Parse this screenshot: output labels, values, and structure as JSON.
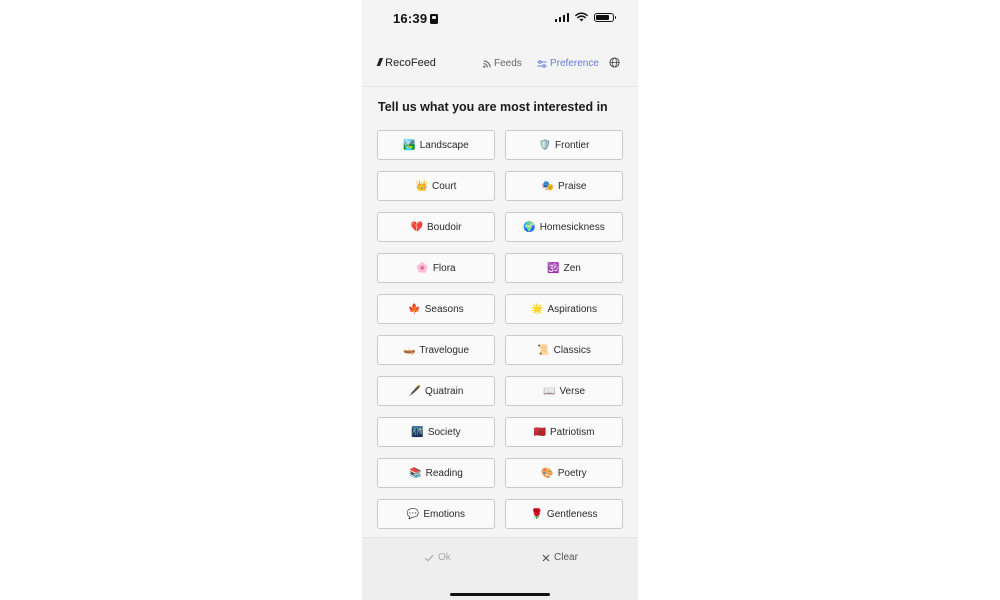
{
  "status": {
    "time": "16:39"
  },
  "header": {
    "brand": "RecoFeed",
    "feeds_label": "Feeds",
    "preference_label": "Preference",
    "accent_color": "#6b78e0"
  },
  "main": {
    "heading": "Tell us what you are most interested in",
    "topics": [
      {
        "emoji": "🏞️",
        "label": "Landscape"
      },
      {
        "emoji": "🛡️",
        "label": "Frontier"
      },
      {
        "emoji": "👑",
        "label": "Court"
      },
      {
        "emoji": "🎭",
        "label": "Praise"
      },
      {
        "emoji": "💔",
        "label": "Boudoir"
      },
      {
        "emoji": "🌍",
        "label": "Homesickness"
      },
      {
        "emoji": "🌸",
        "label": "Flora"
      },
      {
        "emoji": "🕉️",
        "label": "Zen"
      },
      {
        "emoji": "🍁",
        "label": "Seasons"
      },
      {
        "emoji": "🌟",
        "label": "Aspirations"
      },
      {
        "emoji": "🛶",
        "label": "Travelogue"
      },
      {
        "emoji": "📜",
        "label": "Classics"
      },
      {
        "emoji": "🖋️",
        "label": "Quatrain"
      },
      {
        "emoji": "📖",
        "label": "Verse"
      },
      {
        "emoji": "🌃",
        "label": "Society"
      },
      {
        "emoji": "🇲🇦",
        "label": "Patriotism"
      },
      {
        "emoji": "📚",
        "label": "Reading"
      },
      {
        "emoji": "🎨",
        "label": "Poetry"
      },
      {
        "emoji": "💬",
        "label": "Emotions"
      },
      {
        "emoji": "🌹",
        "label": "Gentleness"
      }
    ]
  },
  "footer": {
    "ok_label": "Ok",
    "clear_label": "Clear"
  }
}
